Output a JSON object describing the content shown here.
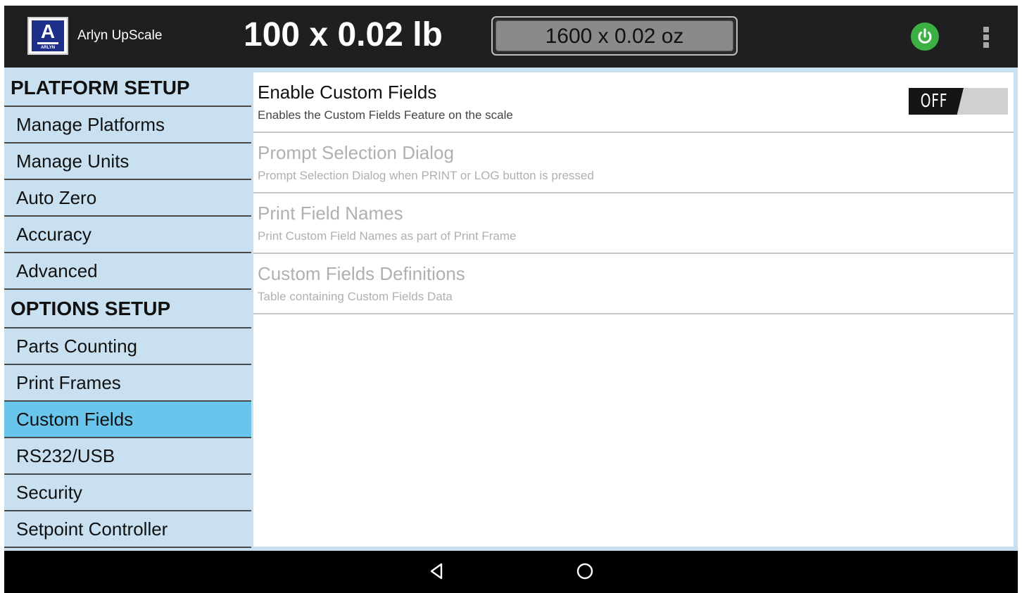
{
  "header": {
    "logo_letter": "A",
    "logo_word": "ARLYN",
    "app_title": "Arlyn UpScale",
    "weight_primary": "100 x 0.02 lb",
    "weight_secondary": "1600 x 0.02 oz",
    "power_color": "#3cb044"
  },
  "sidebar": {
    "platform_header": "PLATFORM SETUP",
    "platform_items": [
      "Manage Platforms",
      "Manage Units",
      "Auto Zero",
      "Accuracy",
      "Advanced"
    ],
    "options_header": "OPTIONS SETUP",
    "options_items": [
      "Parts Counting",
      "Print Frames",
      "Custom Fields",
      "RS232/USB",
      "Security",
      "Setpoint Controller"
    ],
    "selected": "Custom Fields",
    "selected_color": "#6ac5ec",
    "background_color": "#c8e0f0"
  },
  "main": {
    "prefs": [
      {
        "title": "Enable Custom Fields",
        "summary": "Enables the Custom Fields Feature on the scale",
        "enabled": true
      },
      {
        "title": "Prompt Selection Dialog",
        "summary": "Prompt Selection Dialog when PRINT or LOG button is pressed",
        "enabled": false
      },
      {
        "title": "Print Field Names",
        "summary": "Print Custom Field Names as part of Print Frame",
        "enabled": false
      },
      {
        "title": "Custom Fields Definitions",
        "summary": "Table containing Custom Fields Data",
        "enabled": false
      }
    ],
    "toggle_label": "OFF",
    "toggle_state": "off"
  },
  "navbar": {
    "icons": [
      "back-icon",
      "home-icon"
    ]
  }
}
